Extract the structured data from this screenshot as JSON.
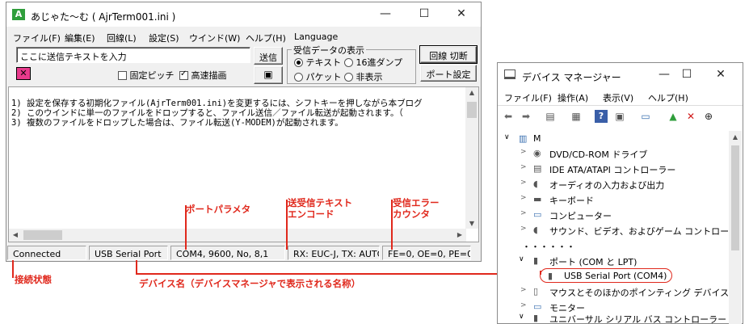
{
  "colors": {
    "annotation": "#e0281c",
    "selection": "#cce8ff",
    "title_icon": "#2f9e3b",
    "disconnected_icon": "#e83a8c"
  },
  "ajr": {
    "title": "あじゃた～む ( AjrTerm001.ini )",
    "caption": {
      "minimize": "—",
      "maximize": "☐",
      "close": "✕"
    },
    "menu": [
      "ファイル(F)",
      "編集(E)",
      "回線(L)",
      "設定(S)",
      "ウインド(W)",
      "ヘルプ(H)",
      "Language"
    ],
    "send_input": "ここに送信テキストを入力",
    "send_button": "送信",
    "fixed_pitch_label": "固定ピッチ",
    "fast_draw_label": "高速描画",
    "fast_draw_checked": true,
    "fixed_pitch_checked": false,
    "display_group": {
      "title": "受信データの表示",
      "options": [
        "テキスト",
        "16進ダンプ",
        "パケット",
        "非表示"
      ],
      "selected": "テキスト"
    },
    "line_toggle_button": "回線 切断",
    "port_settings_button": "ポート設定",
    "log_lines": [
      "1) 設定を保存する初期化ファイル(AjrTerm001.ini)を変更するには、シフトキーを押しながら本ブログ",
      "2) このウインドに単一のファイルをドロップすると、ファイル送信／ファイル転送が起動されます。（",
      "3) 複数のファイルをドロップした場合は、ファイル転送(Y-MODEM)が起動されます。"
    ],
    "status": {
      "connection": "Connected",
      "device": "USB Serial Port",
      "params": "COM4, 9600, No, 8,1",
      "encoding": "RX: EUC-J, TX: AUTO",
      "errors": "FE=0, OE=0, PE=0,"
    }
  },
  "annotations": {
    "port_params": "ポートパラメタ",
    "text_encode": [
      "送受信テキスト",
      "エンコード"
    ],
    "rx_error": [
      "受信エラー",
      "カウンタ"
    ],
    "connection_state": "接続状態",
    "device_name": "デバイス名（デバイスマネージャで表示される名称）"
  },
  "devmgr": {
    "title": "デバイス マネージャー",
    "caption": {
      "minimize": "—",
      "maximize": "☐",
      "close": "✕"
    },
    "menu": [
      "ファイル(F)",
      "操作(A)",
      "表示(V)",
      "ヘルプ(H)"
    ],
    "toolbar_icons": [
      "back-arrow-icon",
      "forward-arrow-icon",
      "properties-icon",
      "details-icon",
      "help-icon",
      "show-hidden-icon",
      "monitor-icon",
      "update-driver-icon",
      "uninstall-icon",
      "download-icon"
    ],
    "root": "M",
    "tree": [
      {
        "label": "DVD/CD-ROM ドライブ",
        "icon": "dvd-drive-icon",
        "expanded": false
      },
      {
        "label": "IDE ATA/ATAPI コントローラー",
        "icon": "ide-controller-icon",
        "expanded": false
      },
      {
        "label": "オーディオの入力および出力",
        "icon": "speaker-icon",
        "expanded": false
      },
      {
        "label": "キーボード",
        "icon": "keyboard-icon",
        "expanded": false
      },
      {
        "label": "コンピューター",
        "icon": "computer-icon",
        "expanded": false
      },
      {
        "label": "サウンド、ビデオ、およびゲーム コントローラー",
        "icon": "sound-icon",
        "expanded": false
      }
    ],
    "ellipsis": "・・・・・・",
    "ports_category": "ポート (COM と LPT)",
    "selected_port": "USB Serial Port (COM4)",
    "tree_after": [
      {
        "label": "マウスとそのほかのポインティング デバイス",
        "icon": "mouse-icon",
        "expanded": false
      },
      {
        "label": "モニター",
        "icon": "monitor-icon",
        "expanded": false
      },
      {
        "label": "ユニバーサル シリアル バス コントローラー",
        "icon": "usb-icon",
        "expanded": true
      }
    ]
  }
}
